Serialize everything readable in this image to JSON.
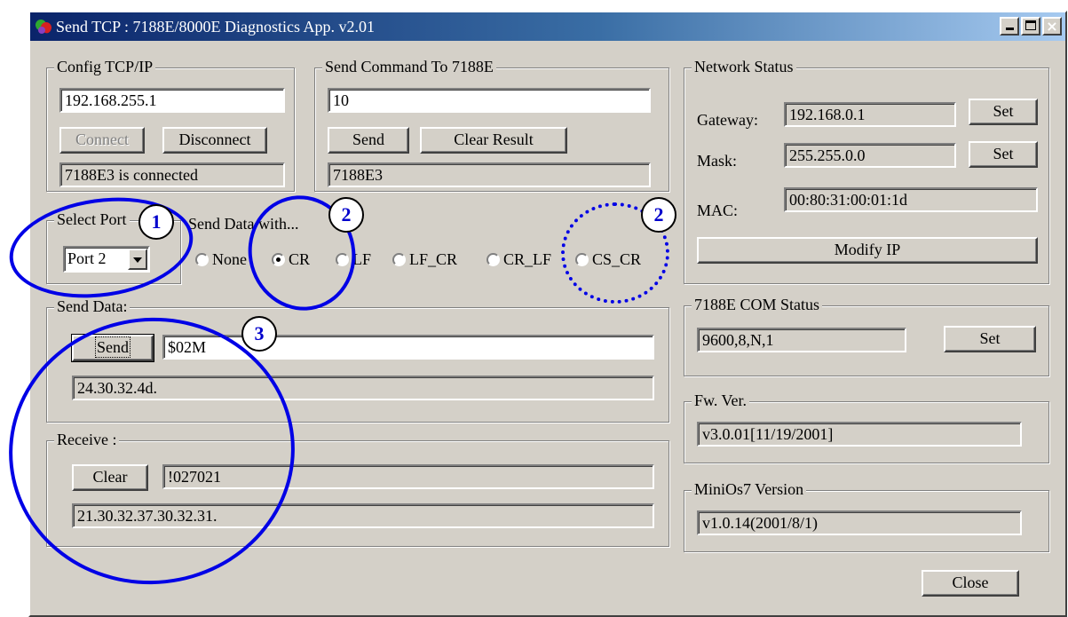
{
  "window": {
    "title": "Send TCP : 7188E/8000E Diagnostics App. v2.01",
    "caption_buttons": {
      "minimize": "",
      "maximize": "",
      "close": "×"
    }
  },
  "config_tcpip": {
    "label": "Config TCP/IP",
    "ip_value": "192.168.255.1",
    "connect_label": "Connect",
    "disconnect_label": "Disconnect",
    "status_text": "7188E3 is connected"
  },
  "send_command": {
    "label": "Send Command To 7188E",
    "command_value": "10",
    "send_label": "Send",
    "clear_result_label": "Clear Result",
    "result_text": "7188E3"
  },
  "select_port": {
    "label": "Select Port",
    "value": "Port 2"
  },
  "send_data_with": {
    "label": "Send Data with...",
    "options": [
      "None",
      "CR",
      "LF",
      "LF_CR",
      "CR_LF",
      "CS_CR"
    ],
    "selected": "CR"
  },
  "send_data": {
    "label": "Send Data:",
    "send_label": "Send",
    "input_value": "$02M",
    "hex_text": "24.30.32.4d."
  },
  "receive": {
    "label": "Receive :",
    "clear_label": "Clear",
    "value": "!027021",
    "hex_text": "21.30.32.37.30.32.31."
  },
  "network_status": {
    "label": "Network Status",
    "gateway_label": "Gateway:",
    "gateway_value": "192.168.0.1",
    "mask_label": "Mask:",
    "mask_value": "255.255.0.0",
    "mac_label": "MAC:",
    "mac_value": "00:80:31:00:01:1d",
    "set_label": "Set",
    "modify_ip_label": "Modify IP"
  },
  "com_status": {
    "label": "7188E COM Status",
    "value": "9600,8,N,1",
    "set_label": "Set"
  },
  "fw_version": {
    "label": "Fw. Ver.",
    "value": "v3.0.01[11/19/2001]"
  },
  "minios7_version": {
    "label": "MiniOs7 Version",
    "value": "v1.0.14(2001/8/1)"
  },
  "close_label": "Close",
  "annotations": [
    "1",
    "2",
    "2",
    "3"
  ],
  "colors": {
    "annotation": "#0000e6",
    "title_bar": "#0a246a",
    "dialog_bg": "#d4d0c8"
  }
}
